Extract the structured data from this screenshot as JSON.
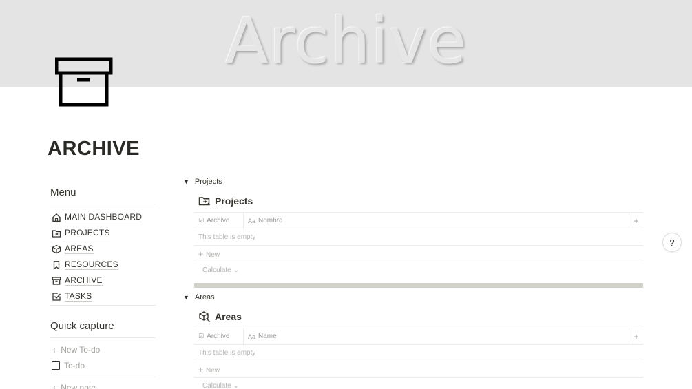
{
  "cover": {
    "text": "Archive"
  },
  "page": {
    "title": "ARCHIVE",
    "icon": "archive-box-icon"
  },
  "menu": {
    "heading": "Menu",
    "items": [
      {
        "label": "MAIN DASHBOARD",
        "icon": "home-icon"
      },
      {
        "label": "PROJECTS",
        "icon": "folder-icon"
      },
      {
        "label": "AREAS",
        "icon": "cube-icon"
      },
      {
        "label": "RESOURCES",
        "icon": "bookmark-icon"
      },
      {
        "label": "ARCHIVE",
        "icon": "archive-icon"
      },
      {
        "label": "TASKS",
        "icon": "checkbox-icon"
      }
    ]
  },
  "quick_capture": {
    "heading": "Quick capture",
    "new_todo": "New To-do",
    "todo": "To-do",
    "new_note": "New note"
  },
  "databases": [
    {
      "toggle_label": "Projects",
      "title": "Projects",
      "columns": [
        "Archive",
        "Nombre"
      ],
      "empty_text": "This table is empty",
      "new_label": "New",
      "calculate_label": "Calculate"
    },
    {
      "toggle_label": "Areas",
      "title": "Areas",
      "columns": [
        "Archive",
        "Name"
      ],
      "empty_text": "This table is empty",
      "new_label": "New",
      "calculate_label": "Calculate"
    }
  ],
  "help": {
    "label": "?"
  }
}
